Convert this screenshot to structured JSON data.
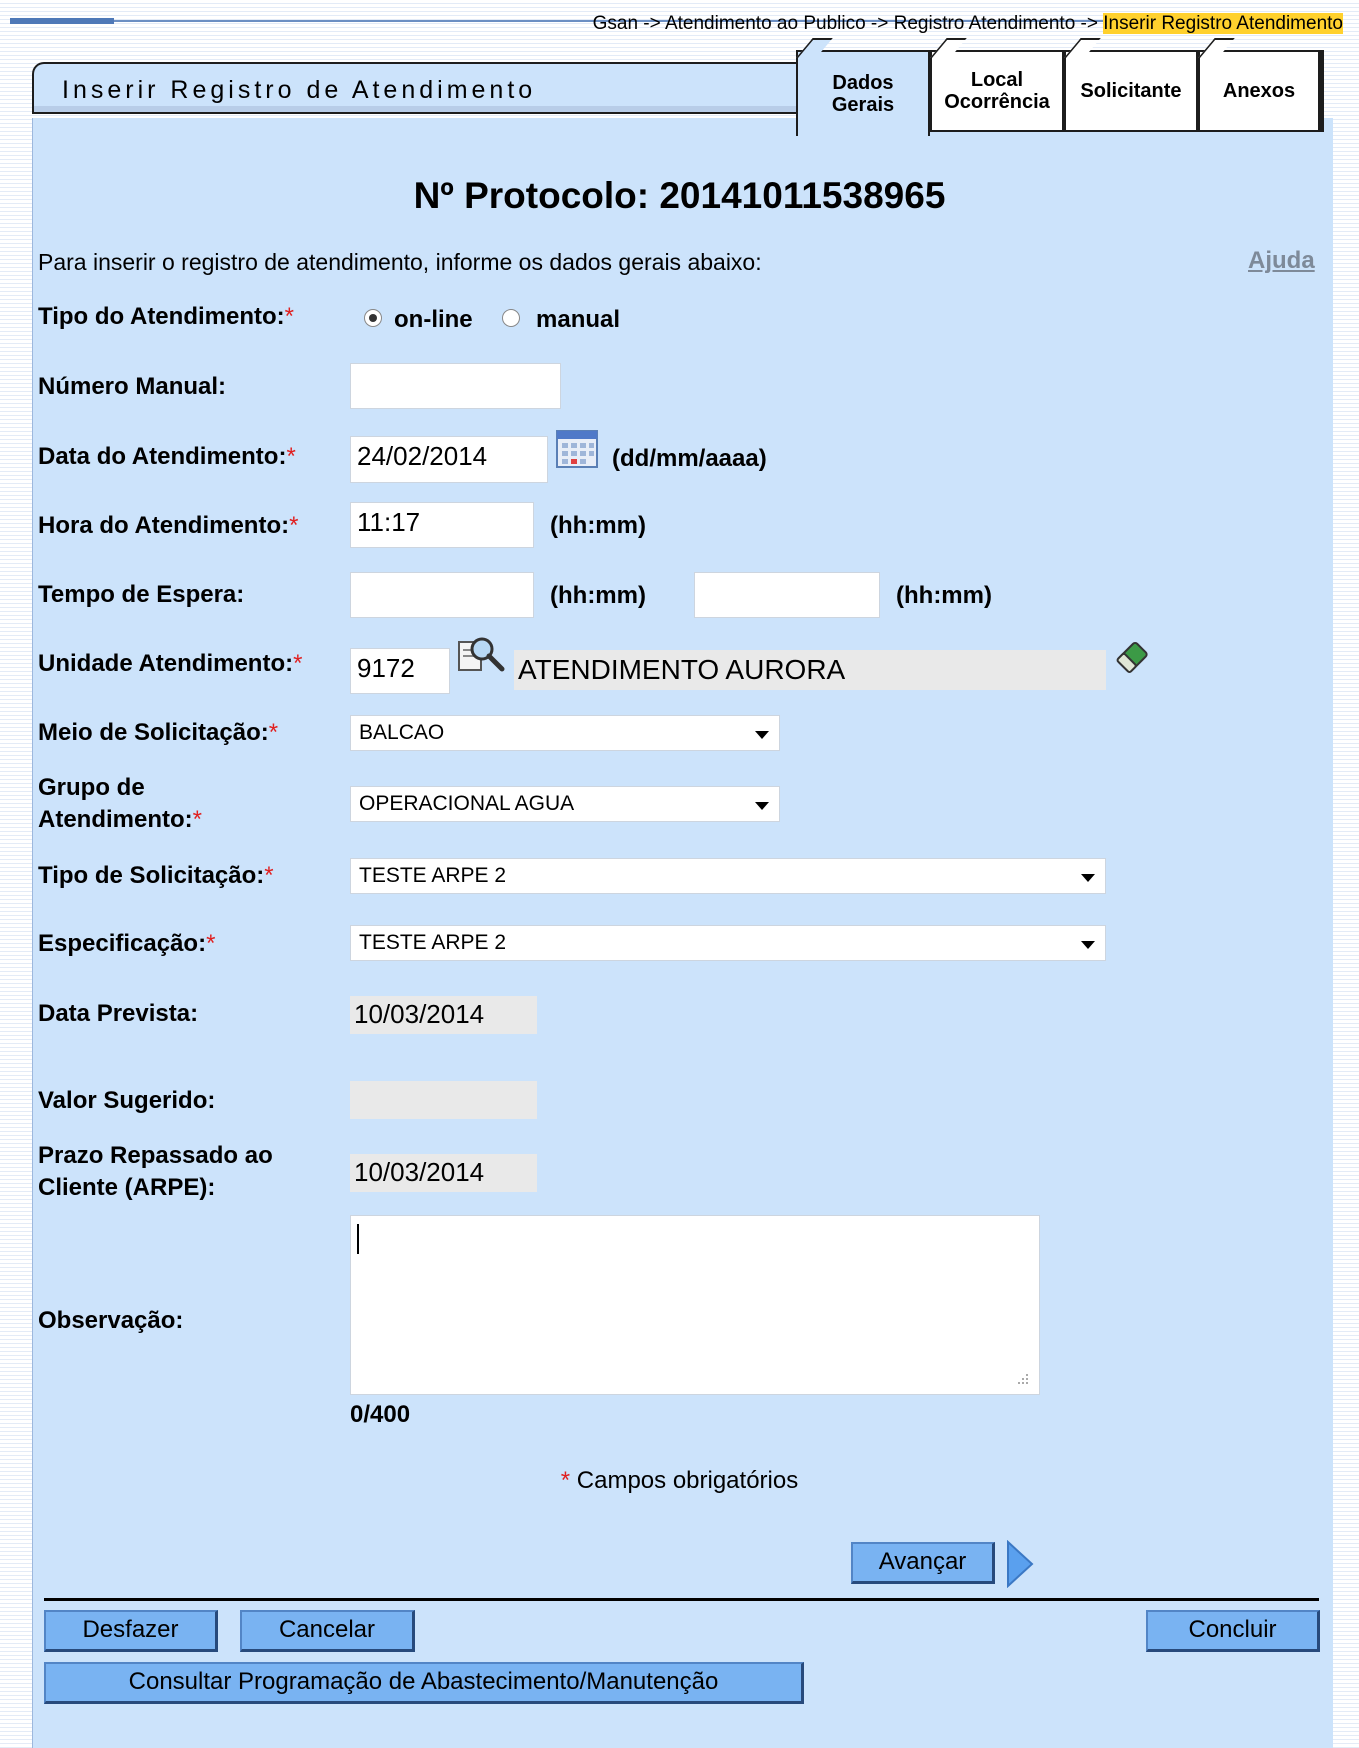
{
  "breadcrumb": {
    "prefix": "Gsan -> Atendimento ao Publico -> Registro Atendimento -> ",
    "current": "Inserir Registro Atendimento"
  },
  "window": {
    "title": "Inserir Registro de Atendimento"
  },
  "tabs": [
    {
      "line1": "Dados",
      "line2": "Gerais",
      "active": true
    },
    {
      "line1": "Local",
      "line2": "Ocorrência",
      "active": false
    },
    {
      "line1": "Solicitante",
      "line2": "",
      "active": false
    },
    {
      "line1": "Anexos",
      "line2": "",
      "active": false
    }
  ],
  "protocol": "Nº Protocolo: 20141011538965",
  "intro": "Para inserir o registro de atendimento, informe os dados gerais abaixo:",
  "help_link": "Ajuda",
  "required_mark": "*",
  "form": {
    "tipo_atendimento": {
      "label": "Tipo do Atendimento:",
      "options": [
        "on-line",
        "manual"
      ],
      "selected": "on-line"
    },
    "numero_manual": {
      "label": "Número Manual:",
      "value": ""
    },
    "data_atendimento": {
      "label": "Data do Atendimento:",
      "value": "24/02/2014",
      "hint": "(dd/mm/aaaa)"
    },
    "hora_atendimento": {
      "label": "Hora do Atendimento:",
      "value": "11:17",
      "hint": "(hh:mm)"
    },
    "tempo_espera": {
      "label": "Tempo de Espera:",
      "start": "",
      "end": "",
      "hint": "(hh:mm)"
    },
    "unidade_atendimento": {
      "label": "Unidade Atendimento:",
      "code": "9172",
      "name": "ATENDIMENTO AURORA"
    },
    "meio_solicitacao": {
      "label": "Meio de Solicitação:",
      "value": "BALCAO"
    },
    "grupo_atendimento": {
      "label_line1": "Grupo de",
      "label_line2": "Atendimento:",
      "value": "OPERACIONAL AGUA"
    },
    "tipo_solicitacao": {
      "label": "Tipo de Solicitação:",
      "value": "TESTE ARPE 2"
    },
    "especificacao": {
      "label": "Especificação:",
      "value": "TESTE ARPE 2"
    },
    "data_prevista": {
      "label": "Data Prevista:",
      "value": "10/03/2014"
    },
    "valor_sugerido": {
      "label": "Valor Sugerido:",
      "value": ""
    },
    "prazo_repassado": {
      "label_line1": "Prazo Repassado ao",
      "label_line2": "Cliente (ARPE):",
      "value": "10/03/2014"
    },
    "observacao": {
      "label": "Observação:",
      "value": "",
      "counter": "0/400"
    }
  },
  "required_note": "Campos obrigatórios",
  "buttons": {
    "avancar": "Avançar",
    "desfazer": "Desfazer",
    "cancelar": "Cancelar",
    "concluir": "Concluir",
    "consultar": "Consultar Programação de Abastecimento/Manutenção"
  },
  "colors": {
    "panel": "#cce3fb",
    "button": "#79b3f2",
    "highlight": "#ffd12e",
    "required": "#e02020"
  }
}
